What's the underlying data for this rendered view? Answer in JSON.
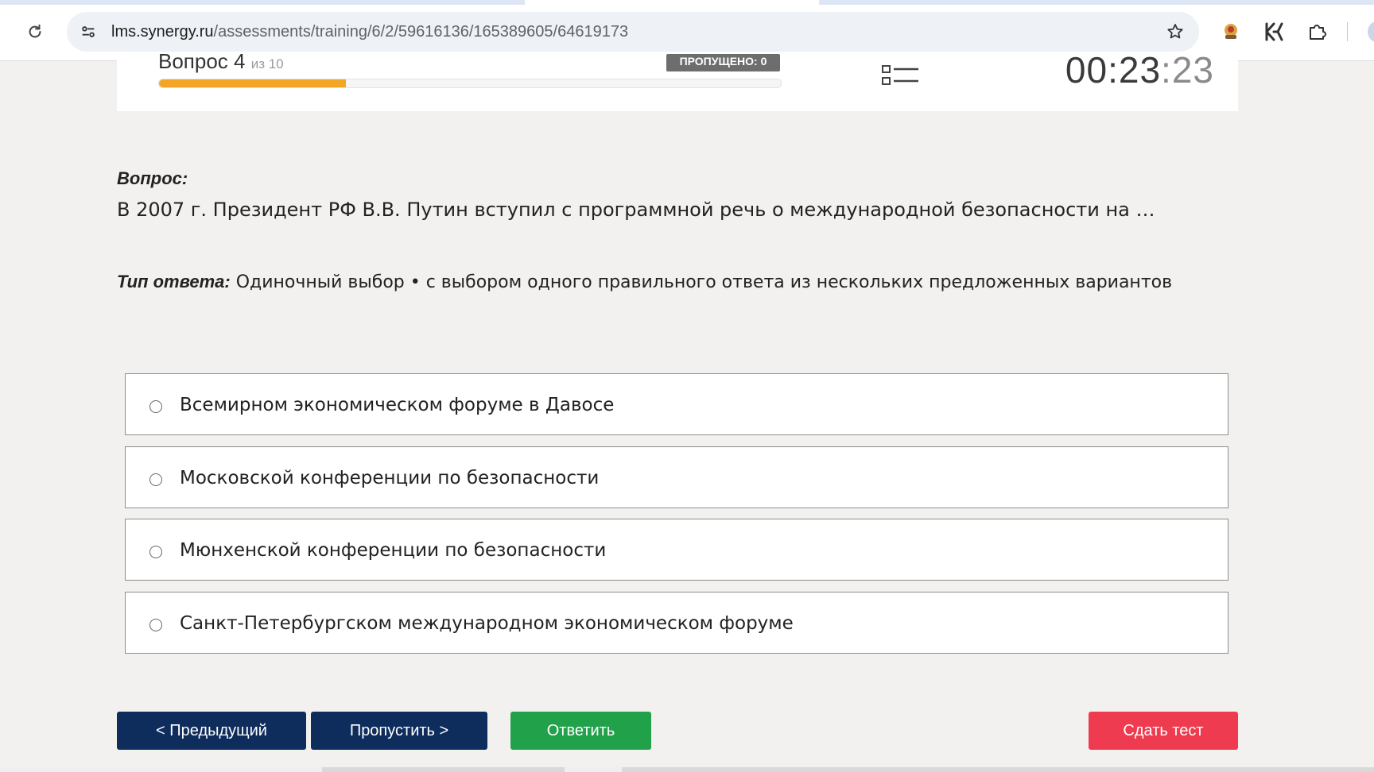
{
  "browser": {
    "url_host": "lms.synergy.ru",
    "url_path": "/assessments/training/6/2/59616136/165389605/64619173",
    "icons": [
      "reload-icon",
      "site-info-icon",
      "bookmark-star-icon",
      "extension-avatar-icon",
      "extension-k-icon",
      "extensions-puzzle-icon"
    ]
  },
  "header": {
    "question_counter": "Вопрос 4",
    "question_of": "из 10",
    "skipped_badge": "ПРОПУЩЕНО: 0",
    "progress_fraction": 0.3,
    "timer_main": "00:23",
    "timer_seconds": ":23"
  },
  "question": {
    "label": "Вопрос:",
    "text": "В 2007 г. Президент РФ В.В. Путин вступил с программной речь о международной безопасности на …",
    "answer_type_label": "Тип ответа:",
    "answer_type_value": "Одиночный выбор • с выбором одного правильного ответа из нескольких предложенных вариантов"
  },
  "options": [
    {
      "text": "Всемирном экономическом форуме в Давосе"
    },
    {
      "text": "Московской конференции по безопасности"
    },
    {
      "text": "Мюнхенской конференции по безопасности"
    },
    {
      "text": "Санкт-Петербургском международном экономическом форуме"
    }
  ],
  "buttons": {
    "prev": "< Предыдущий",
    "skip": "Пропустить >",
    "answer": "Ответить",
    "submit": "Сдать тест"
  },
  "colors": {
    "progress": "#f3a626",
    "nav_button": "#0e2d5c",
    "answer_button": "#22a14b",
    "submit_button": "#ee3b4f"
  }
}
